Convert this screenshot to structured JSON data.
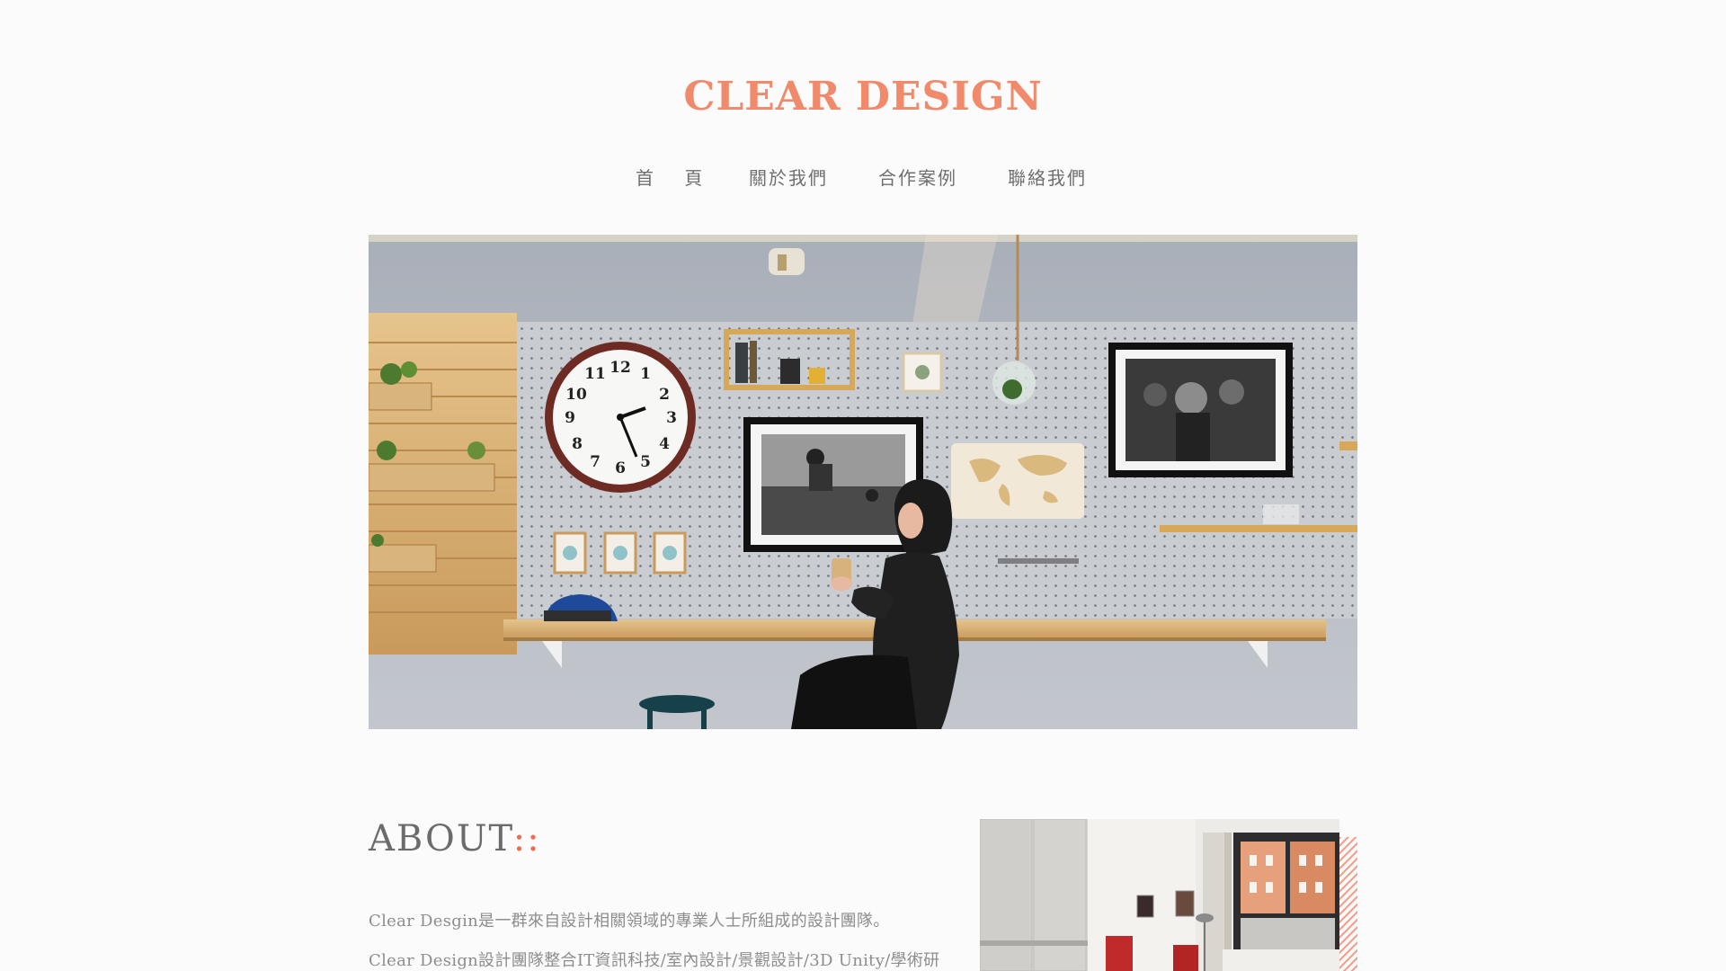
{
  "brand": {
    "logo_text": "CLEAR DESIGN",
    "accent_color": "#f08a6a"
  },
  "nav": {
    "items": [
      {
        "label": "首 頁"
      },
      {
        "label": "關於我們"
      },
      {
        "label": "合作案例"
      },
      {
        "label": "聯絡我們"
      }
    ]
  },
  "hero": {
    "clock_numbers": [
      "12",
      "1",
      "2",
      "3",
      "4",
      "5",
      "6",
      "7",
      "8",
      "9",
      "10",
      "11"
    ]
  },
  "about": {
    "title": "ABOUT",
    "title_accent": "::",
    "paragraph_1": "Clear Desgin是一群來自設計相關領域的專業人士所組成的設計團隊。",
    "paragraph_2": "Clear Design設計團隊整合IT資訊科技/室內設計/景觀設計/3D Unity/學術研發等各領域的Domain KnowHow，為客戶設計需求提供最適切的解決方"
  }
}
